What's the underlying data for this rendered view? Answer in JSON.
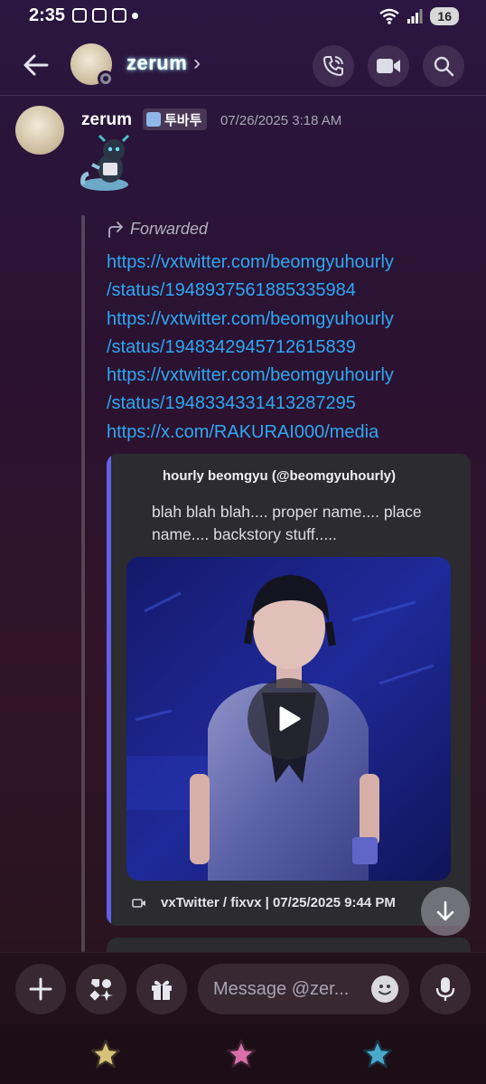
{
  "status_bar": {
    "time": "2:35",
    "battery": "16"
  },
  "header": {
    "name": "zerum",
    "chevron": "›"
  },
  "message": {
    "author": "zerum",
    "badge": "투바투",
    "timestamp": "07/26/2025 3:18 AM",
    "forwarded_label": "Forwarded",
    "links": [
      "https://vxtwitter.com/beomgyuhourly",
      "/status/1948937561885335984",
      "https://vxtwitter.com/beomgyuhourly",
      "/status/1948342945712615839",
      "https://vxtwitter.com/beomgyuhourly",
      "/status/1948334331413287295",
      "https://x.com/RAKURAI000/media"
    ],
    "embed": {
      "author": "hourly beomgyu (@beomgyuhourly)",
      "description": "blah blah blah.... proper name.... place name.... backstory stuff.....",
      "footer": "vxTwitter / fixvx | 07/25/2025 9:44 PM",
      "accent_color": "#6360e8"
    }
  },
  "composer": {
    "placeholder": "Message @zer..."
  },
  "colors": {
    "link": "#2ea8f3",
    "embed_bg": "#2b2b30"
  }
}
